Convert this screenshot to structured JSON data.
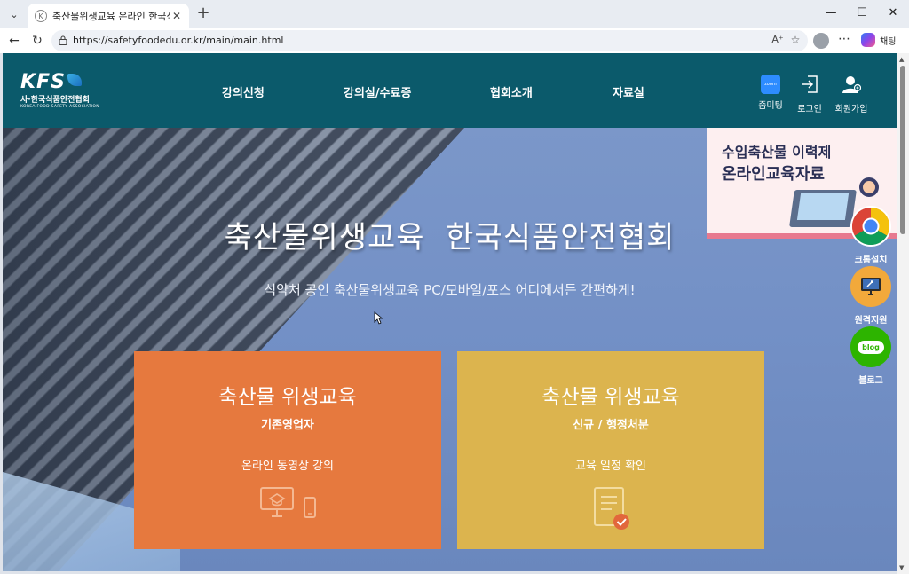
{
  "browser": {
    "tab_title": "축산물위생교육 온라인 한국식품",
    "tab_favicon": "K",
    "url": "https://safetyfoodedu.or.kr/main/main.html",
    "chat_label": "채팅",
    "icons": [
      "tab-list-icon",
      "close-icon",
      "plus-icon",
      "minimize-icon",
      "maximize-icon",
      "window-close-icon",
      "back-icon",
      "refresh-icon",
      "lock-icon",
      "read-aloud-icon",
      "favorite-star-icon",
      "profile-icon",
      "more-icon",
      "copilot-icon"
    ]
  },
  "header": {
    "logo_mark": "KFS",
    "logo_ko": "사·한국식품안전협회",
    "logo_en": "KOREA FOOD SAFETY ASSOCIATION",
    "nav": [
      {
        "label": "강의신청"
      },
      {
        "label": "강의실/수료증"
      },
      {
        "label": "협회소개"
      },
      {
        "label": "자료실"
      }
    ],
    "utility": [
      {
        "label": "줌미팅",
        "icon": "zoom-icon",
        "icon_text": "zoom"
      },
      {
        "label": "로그인",
        "icon": "login-icon"
      },
      {
        "label": "회원가입",
        "icon": "user-add-icon"
      }
    ],
    "color": "#0b5a6b"
  },
  "hero": {
    "title": "축산물위생교육  한국식품안전협회",
    "subtitle": "식약처 공인 축산물위생교육 PC/모바일/포스 어디에서든 간편하게!"
  },
  "banner": {
    "line1": "수입축산물 이력제",
    "line2": "온라인교육자료"
  },
  "quick_links": [
    {
      "label": "크롬설치",
      "icon": "chrome-icon"
    },
    {
      "label": "원격지원",
      "icon": "remote-support-icon"
    },
    {
      "label": "블로그",
      "icon": "blog-icon",
      "icon_text": "blog"
    }
  ],
  "cards": [
    {
      "title": "축산물 위생교육",
      "subtitle": "기존영업자",
      "description": "온라인 동영상 강의",
      "color": "#e6793e",
      "icon": "monitor-mobile-icon"
    },
    {
      "title": "축산물 위생교육",
      "subtitle": "신규 / 행정처분",
      "description": "교육 일정 확인",
      "color": "#dcb44e",
      "icon": "document-check-icon"
    }
  ]
}
